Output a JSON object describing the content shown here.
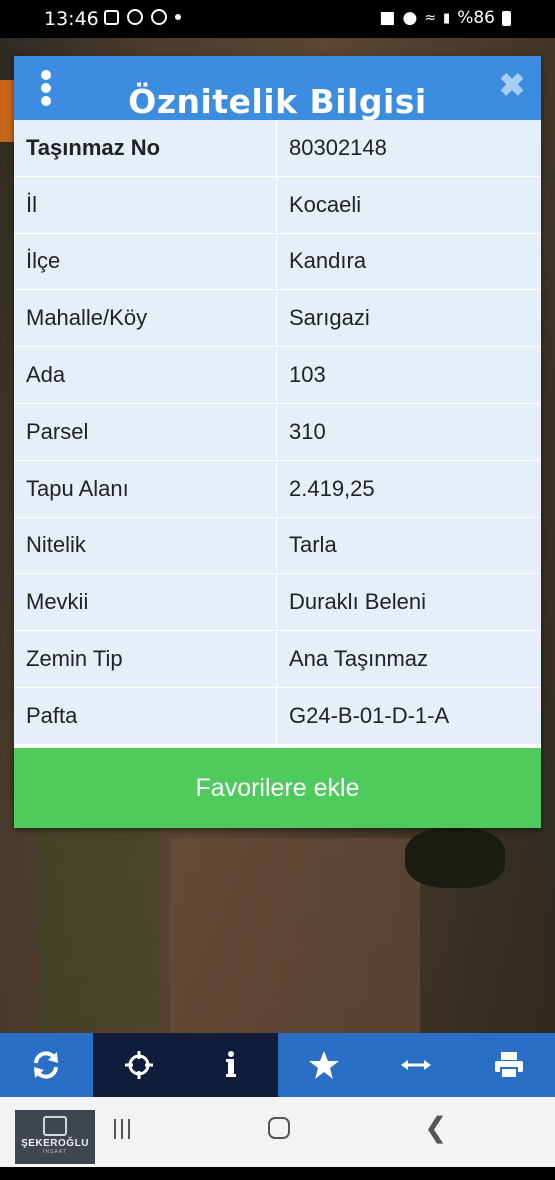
{
  "status_bar": {
    "time": "13:46",
    "battery": "%86",
    "icons": [
      "gallery-icon",
      "chrome-icon",
      "chrome-icon",
      "dot-icon",
      "lock-icon",
      "location-icon",
      "wifi-icon",
      "volte-icon",
      "signal-icon",
      "battery-icon"
    ]
  },
  "dialog": {
    "title": "Öznitelik Bilgisi",
    "rows": [
      {
        "key": "Taşınmaz No",
        "value": "80302148"
      },
      {
        "key": "İl",
        "value": "Kocaeli"
      },
      {
        "key": "İlçe",
        "value": "Kandıra"
      },
      {
        "key": "Mahalle/Köy",
        "value": "Sarıgazi"
      },
      {
        "key": "Ada",
        "value": "103"
      },
      {
        "key": "Parsel",
        "value": "310"
      },
      {
        "key": "Tapu Alanı",
        "value": "2.419,25"
      },
      {
        "key": "Nitelik",
        "value": "Tarla"
      },
      {
        "key": "Mevkii",
        "value": "Duraklı Beleni"
      },
      {
        "key": "Zemin Tip",
        "value": "Ana Taşınmaz"
      },
      {
        "key": "Pafta",
        "value": "G24-B-01-D-1-A"
      }
    ],
    "favorite_button": "Favorilere ekle"
  },
  "toolbar": {
    "items": [
      "refresh-icon",
      "crosshair-icon",
      "info-icon",
      "star-icon",
      "measure-icon",
      "print-icon"
    ],
    "active": "info-icon"
  },
  "logo": {
    "name": "ŞEKEROĞLU",
    "sub": "İNŞAAT"
  },
  "colors": {
    "header": "#3c8de0",
    "row_bg": "#e5eef9",
    "button": "#4fcb5e",
    "toolbar": "#2a6fc6",
    "toolbar_active": "#0f1d3a"
  }
}
